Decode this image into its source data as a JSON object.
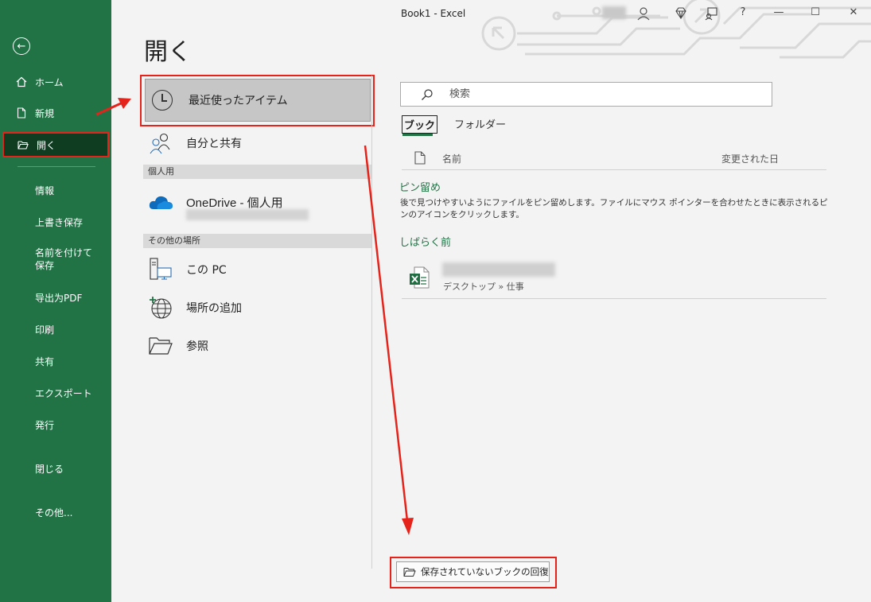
{
  "window": {
    "title": "Book1  -  Excel",
    "help": "?",
    "minimize": "—",
    "maximize": "☐",
    "close": "✕"
  },
  "sidebar": {
    "back": "←",
    "home": "ホーム",
    "new": "新規",
    "open": "開く",
    "info": "情報",
    "save": "上書き保存",
    "save_as": "名前を付けて保存",
    "export_pdf": "导出为PDF",
    "print": "印刷",
    "share": "共有",
    "export": "エクスポート",
    "publish": "発行",
    "close": "閉じる",
    "more": "その他..."
  },
  "page": {
    "title": "開く"
  },
  "locations": {
    "recent": "最近使ったアイテム",
    "shared": "自分と共有",
    "personal_section": "個人用",
    "onedrive": "OneDrive - 個人用",
    "other_section": "その他の場所",
    "this_pc": "この PC",
    "add_place": "場所の追加",
    "browse": "参照"
  },
  "search": {
    "placeholder": "検索"
  },
  "tabs": {
    "book": "ブック",
    "folder": "フォルダー"
  },
  "list": {
    "col_name": "名前",
    "col_modified": "変更された日",
    "pinned_title": "ピン留め",
    "pinned_desc": "後で見つけやすいようにファイルをピン留めします。ファイルにマウス ポインターを合わせたときに表示されるピンのアイコンをクリックします。",
    "recent_title": "しばらく前",
    "file_path": "デスクトップ » 仕事"
  },
  "recover": {
    "label": "保存されていないブックの回復"
  }
}
